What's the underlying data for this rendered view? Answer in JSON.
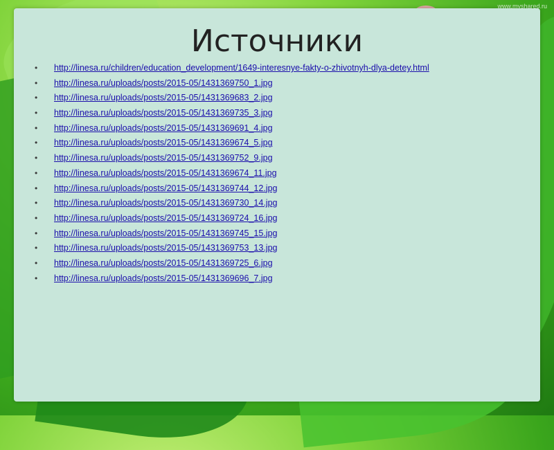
{
  "watermark": "www.myshared.ru",
  "slide": {
    "title": "Источники",
    "bullet_char": "•",
    "links": [
      "http://linesa.ru/children/education_development/1649-interesnye-fakty-o-zhivotnyh-dlya-detey.html",
      "http://linesa.ru/uploads/posts/2015-05/1431369750_1.jpg",
      "http://linesa.ru/uploads/posts/2015-05/1431369683_2.jpg",
      "http://linesa.ru/uploads/posts/2015-05/1431369735_3.jpg",
      "http://linesa.ru/uploads/posts/2015-05/1431369691_4.jpg",
      "http://linesa.ru/uploads/posts/2015-05/1431369674_5.jpg",
      "http://linesa.ru/uploads/posts/2015-05/1431369752_9.jpg",
      "http://linesa.ru/uploads/posts/2015-05/1431369674_11.jpg",
      "http://linesa.ru/uploads/posts/2015-05/1431369744_12.jpg",
      "http://linesa.ru/uploads/posts/2015-05/1431369730_14.jpg",
      "http://linesa.ru/uploads/posts/2015-05/1431369724_16.jpg",
      "http://linesa.ru/uploads/posts/2015-05/1431369745_15.jpg",
      "http://linesa.ru/uploads/posts/2015-05/1431369753_13.jpg",
      "http://linesa.ru/uploads/posts/2015-05/1431369725_6.jpg",
      "http://linesa.ru/uploads/posts/2015-05/1431369696_7.jpg"
    ]
  },
  "colors": {
    "panel_bg": "#c8e6da",
    "link": "#1a0dab",
    "title": "#222222",
    "background_green": "#3aa51c"
  }
}
